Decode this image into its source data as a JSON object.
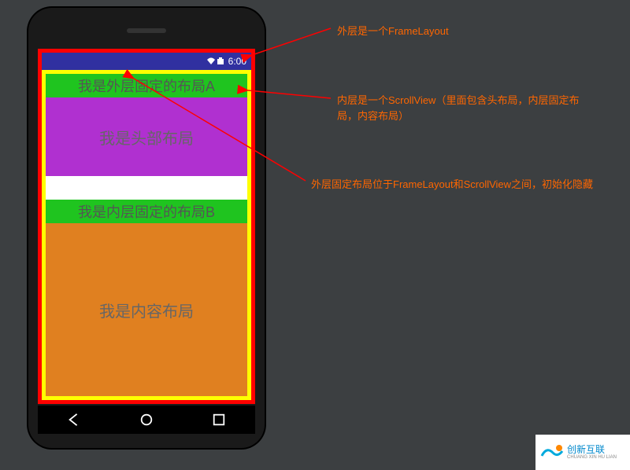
{
  "status": {
    "time": "6:00"
  },
  "labels": {
    "fixedA": "我是外层固定的布局A",
    "header": "我是头部布局",
    "fixedB": "我是内层固定的布局B",
    "content": "我是内容布局"
  },
  "annotations": {
    "a1": "外层是一个FrameLayout",
    "a2": "内层是一个ScrollView（里面包含头布局，内层固定布局，内容布局）",
    "a3": "外层固定布局位于FrameLayout和ScrollView之间，初始化隐藏"
  },
  "watermark": {
    "brand": "创新互联",
    "sub": "CHUANG XIN HU LIAN"
  }
}
